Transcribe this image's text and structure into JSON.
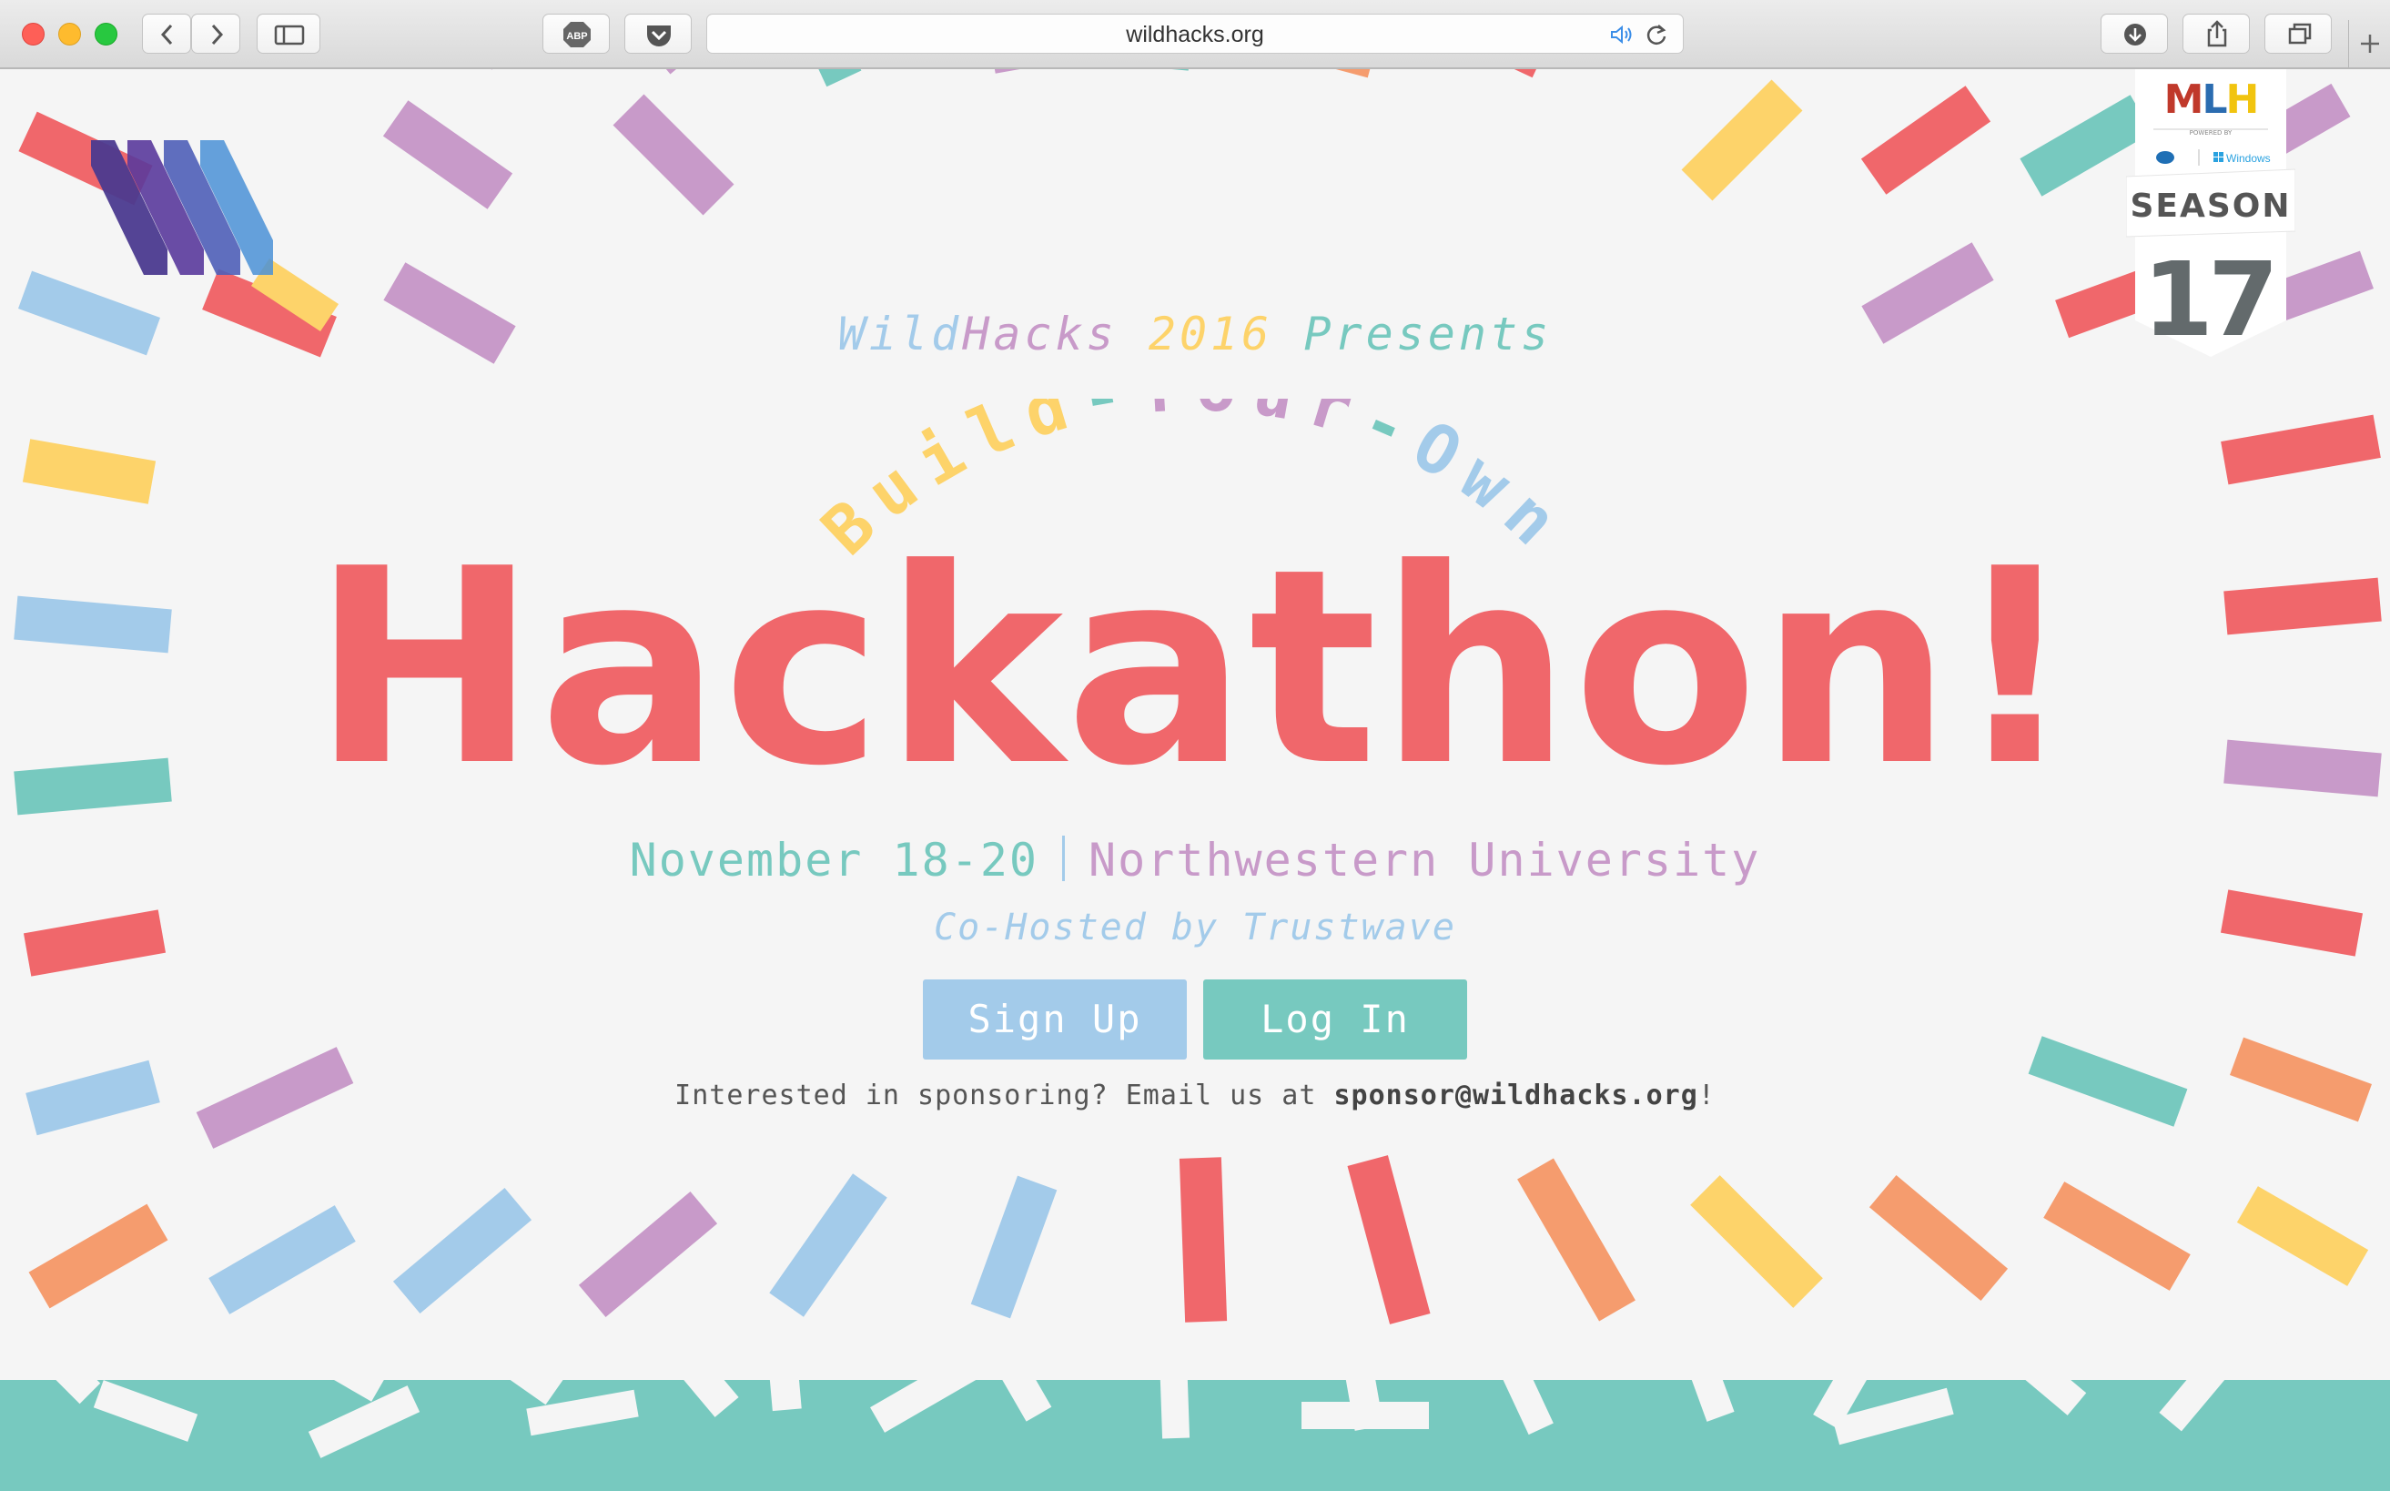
{
  "browser": {
    "url": "wildhacks.org",
    "traffic_lights": [
      "#fe5f57",
      "#febb2e",
      "#28c840"
    ],
    "toolbar_icons": [
      "back-icon",
      "forward-icon",
      "sidebar-icon",
      "adblock-icon",
      "pocket-icon",
      "audio-icon",
      "reload-icon",
      "download-icon",
      "share-icon",
      "tabs-icon",
      "new-tab-icon"
    ],
    "adblock_label": "ABP"
  },
  "hero": {
    "presents": {
      "wild": "WildHacks",
      "year": "2016",
      "presents": "Presents",
      "colors": {
        "wild": "#a3cbea",
        "hacks": "#c89ac9",
        "year": "#fdd36a",
        "presents": "#77c9bf"
      }
    },
    "arc_title": {
      "build": "Build",
      "your": "Your",
      "own": "Own",
      "dash": "-",
      "colors": {
        "build": "#fdd36a",
        "dash": "#77c9bf",
        "your": "#c89ac9",
        "own": "#a3cbea"
      }
    },
    "headline": "Hackathon!",
    "date": "November 18-20",
    "location": "Northwestern University",
    "cohost": "Co-Hosted by Trustwave",
    "signup_label": "Sign Up",
    "login_label": "Log In",
    "sponsor_prefix": "Interested in sponsoring? Email us at ",
    "sponsor_email": "sponsor@wildhacks.org",
    "sponsor_suffix": "!"
  },
  "mlh_badge": {
    "logo": "MLH",
    "powered_by": "POWERED BY",
    "partner_windows": "Windows",
    "season_label": "SEASON",
    "season_number": "17"
  },
  "palette": {
    "red": "#f0676b",
    "purple": "#c89ac9",
    "blue": "#a3cbea",
    "teal": "#77c9bf",
    "yellow": "#fdd36a",
    "orange": "#f59c6e"
  }
}
